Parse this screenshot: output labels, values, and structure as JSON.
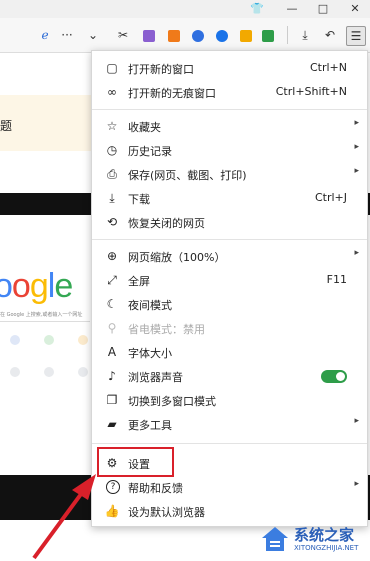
{
  "window": {
    "buttons": {
      "pin": "👕",
      "minimize": "—",
      "maximize": "□",
      "close": "✕"
    }
  },
  "toolbar": {
    "icons": [
      "ie-mode-icon",
      "more-icon",
      "chevron-down-icon",
      "scissors-icon",
      "extension-icon",
      "extension-icon",
      "extension-icon",
      "extension-icon",
      "extension-icon",
      "extension-icon",
      "download-icon",
      "undo-icon",
      "menu-icon"
    ],
    "glyphs": {
      "ie": "ℯ",
      "more": "···",
      "chevron": "⌄",
      "scissors": "✂",
      "download": "⤓",
      "undo": "↶",
      "menu": "☰"
    }
  },
  "page": {
    "notice_text": "题",
    "google_logo": "oogle",
    "search_hint": "在 Google 上搜索,或者输入一个网址"
  },
  "menu": {
    "items": [
      {
        "icon": "▢",
        "label": "打开新的窗口",
        "shortcut": "Ctrl+N"
      },
      {
        "icon": "∞",
        "label": "打开新的无痕窗口",
        "shortcut": "Ctrl+Shift+N"
      },
      {
        "icon": "☆",
        "label": "收藏夹",
        "arrow": "▸"
      },
      {
        "icon": "◷",
        "label": "历史记录",
        "arrow": "▸"
      },
      {
        "icon": "⎙",
        "label": "保存(网页、截图、打印)",
        "arrow": "▸"
      },
      {
        "icon": "⤓",
        "label": "下载",
        "shortcut": "Ctrl+J"
      },
      {
        "icon": "⟲",
        "label": "恢复关闭的网页"
      },
      {
        "icon": "⊕",
        "label": "网页缩放（100%）",
        "arrow": "▸"
      },
      {
        "icon": "⤢",
        "label": "全屏",
        "shortcut": "F11"
      },
      {
        "icon": "☾",
        "label": "夜间模式"
      },
      {
        "icon": "⚲",
        "label": "省电模式：禁用"
      },
      {
        "icon": "A",
        "label": "字体大小"
      },
      {
        "icon": "♪",
        "label": "浏览器声音"
      },
      {
        "icon": "❐",
        "label": "切换到多窗口模式"
      },
      {
        "icon": "▰",
        "label": "更多工具",
        "arrow": "▸"
      },
      {
        "icon": "⚙",
        "label": "设置"
      },
      {
        "icon": "?",
        "label": "帮助和反馈",
        "arrow": "▸"
      },
      {
        "icon": "👍",
        "label": "设为默认浏览器"
      }
    ]
  },
  "watermark": {
    "name": "系统之家",
    "domain": "XITONGZHIJIA.NET"
  },
  "colors": {
    "highlight": "#d9202a",
    "toggle_on": "#2e9d49",
    "accent": "#1a73e8"
  }
}
